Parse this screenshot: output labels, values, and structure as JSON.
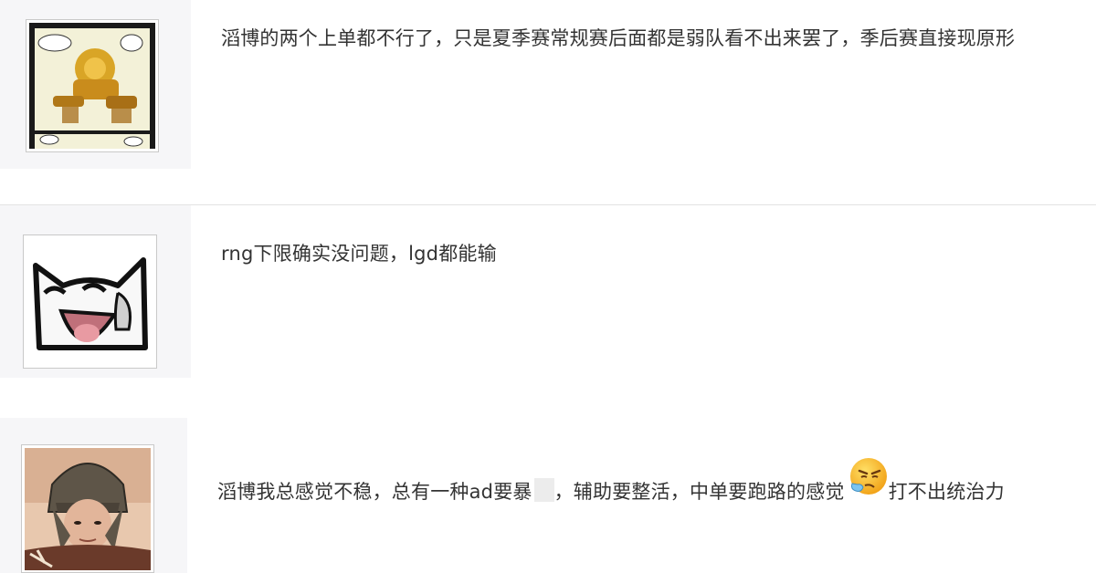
{
  "comments": [
    {
      "avatar_icon": "mecha-comic-avatar-icon",
      "text": "滔博的两个上单都不行了，只是夏季赛常规赛后面都是弱队看不出来罢了，季后赛直接现原形"
    },
    {
      "avatar_icon": "white-cat-laugh-avatar-icon",
      "text": "rng下限确实没问题，lgd都能输"
    },
    {
      "avatar_icon": "helmet-soldier-avatar-icon",
      "text_part1": "滔博我总感觉不稳，总有一种ad要暴",
      "text_part2": "，辅助要整活，中单要跑路的感觉",
      "emoji_icon": "sneeze-face-emoji-icon",
      "text_part3": "打不出统治力"
    }
  ]
}
